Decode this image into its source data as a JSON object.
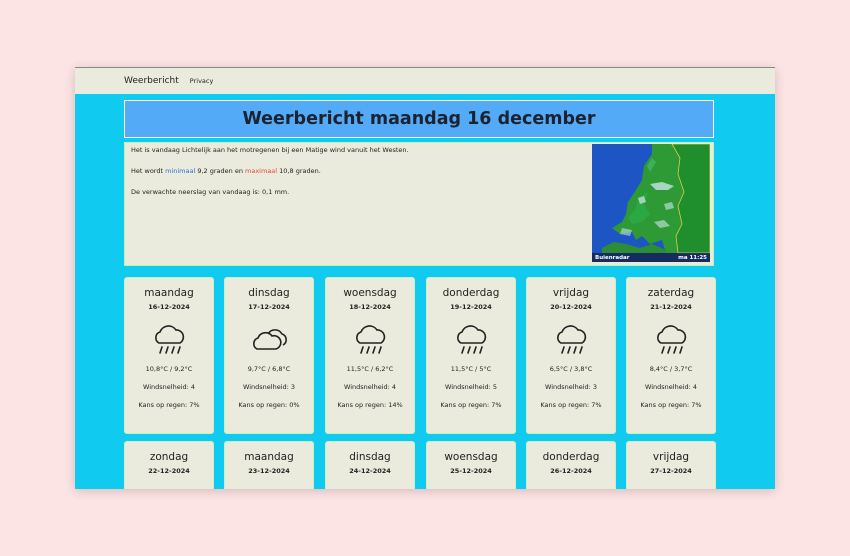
{
  "navbar": {
    "brand": "Weerbericht",
    "privacy": "Privacy"
  },
  "title": "Weerbericht maandag 16 december",
  "info": {
    "line1": "Het is vandaag Lichtelijk aan het motregenen bij een Matige wind vanuit het Westen.",
    "line2_prefix": "Het wordt ",
    "min_label": "minimaal",
    "min_value": " 9,2 graden en ",
    "max_label": "maximaal",
    "max_value": " 10,8 graden.",
    "line3": "De verwachte neerslag van vandaag is: 0,1 mm."
  },
  "radar": {
    "brand": "Buienradar",
    "time": "ma 11:25"
  },
  "forecast": [
    {
      "day": "maandag",
      "date": "16-12-2024",
      "icon": "cloud-rain-icon",
      "temp": "10,8°C / 9,2°C",
      "wind": "Windsnelheid: 4",
      "rain": "Kans op regen: 7%"
    },
    {
      "day": "dinsdag",
      "date": "17-12-2024",
      "icon": "cloudy-icon",
      "temp": "9,7°C / 6,8°C",
      "wind": "Windsnelheid: 3",
      "rain": "Kans op regen: 0%"
    },
    {
      "day": "woensdag",
      "date": "18-12-2024",
      "icon": "cloud-rain-icon",
      "temp": "11,5°C / 6,2°C",
      "wind": "Windsnelheid: 4",
      "rain": "Kans op regen: 14%"
    },
    {
      "day": "donderdag",
      "date": "19-12-2024",
      "icon": "cloud-rain-icon",
      "temp": "11,5°C / 5°C",
      "wind": "Windsnelheid: 5",
      "rain": "Kans op regen: 7%"
    },
    {
      "day": "vrijdag",
      "date": "20-12-2024",
      "icon": "cloud-rain-icon",
      "temp": "6,5°C / 3,8°C",
      "wind": "Windsnelheid: 3",
      "rain": "Kans op regen: 7%"
    },
    {
      "day": "zaterdag",
      "date": "21-12-2024",
      "icon": "cloud-rain-icon",
      "temp": "8,4°C / 3,7°C",
      "wind": "Windsnelheid: 4",
      "rain": "Kans op regen: 7%"
    },
    {
      "day": "zondag",
      "date": "22-12-2024"
    },
    {
      "day": "maandag",
      "date": "23-12-2024"
    },
    {
      "day": "dinsdag",
      "date": "24-12-2024"
    },
    {
      "day": "woensdag",
      "date": "25-12-2024"
    },
    {
      "day": "donderdag",
      "date": "26-12-2024"
    },
    {
      "day": "vrijdag",
      "date": "27-12-2024"
    }
  ]
}
